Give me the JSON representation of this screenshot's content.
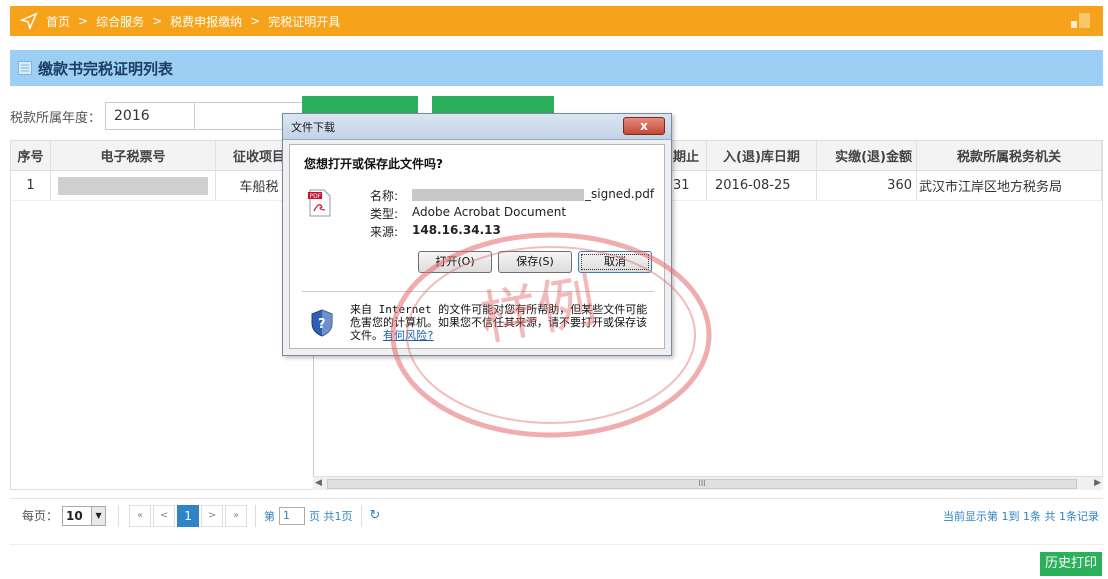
{
  "breadcrumb": {
    "items": [
      "首页",
      "综合服务",
      "税费申报缴纳",
      "完税证明开具"
    ],
    "separator": ">"
  },
  "page_title": "缴款书完税证明列表",
  "filter": {
    "year_label": "税款所属年度：",
    "year_value": "2016"
  },
  "table": {
    "headers": [
      "序号",
      "电子税票号",
      "征收项目",
      "",
      "期止",
      "入(退)库日期",
      "实缴(退)金额",
      "税款所属税务机关"
    ],
    "rows": [
      {
        "index": "1",
        "tax_item": "车船税",
        "period_end": "31",
        "date": "2016-08-25",
        "amount": "360",
        "authority": "武汉市江岸区地方税务局"
      }
    ],
    "scroll_thumb_mark": "III"
  },
  "pager": {
    "per_page_label": "每页：",
    "per_page_value": "10",
    "first": "«",
    "prev": "<",
    "current_page": "1",
    "next": ">",
    "last": "»",
    "page_prefix": "第",
    "page_input": "1",
    "page_suffix": "页 共1页",
    "refresh": "↻",
    "summary": "当前显示第 1到 1条 共 1条记录"
  },
  "history_print_label": "历史打印",
  "dialog": {
    "title": "文件下载",
    "close_label": "x",
    "question": "您想打开或保存此文件吗?",
    "name_key": "名称:",
    "name_suffix": "_signed.pdf",
    "type_key": "类型:",
    "type_value": "Adobe Acrobat Document",
    "source_key": "来源:",
    "source_value": "148.16.34.13",
    "open_label": "打开(O)",
    "save_label": "保存(S)",
    "cancel_label": "取消",
    "warning": "来自 Internet 的文件可能对您有所帮助，但某些文件可能危害您的计算机。如果您不信任其来源，请不要打开或保存该文件。",
    "risk_link": "有何风险?"
  },
  "watermark": "样例",
  "colors": {
    "topbar": "#f7a21b",
    "titleband": "#9ccff3",
    "accent_green": "#2bb05b",
    "accent_blue": "#2f83c7",
    "stamp_red": "#e36a6a"
  }
}
